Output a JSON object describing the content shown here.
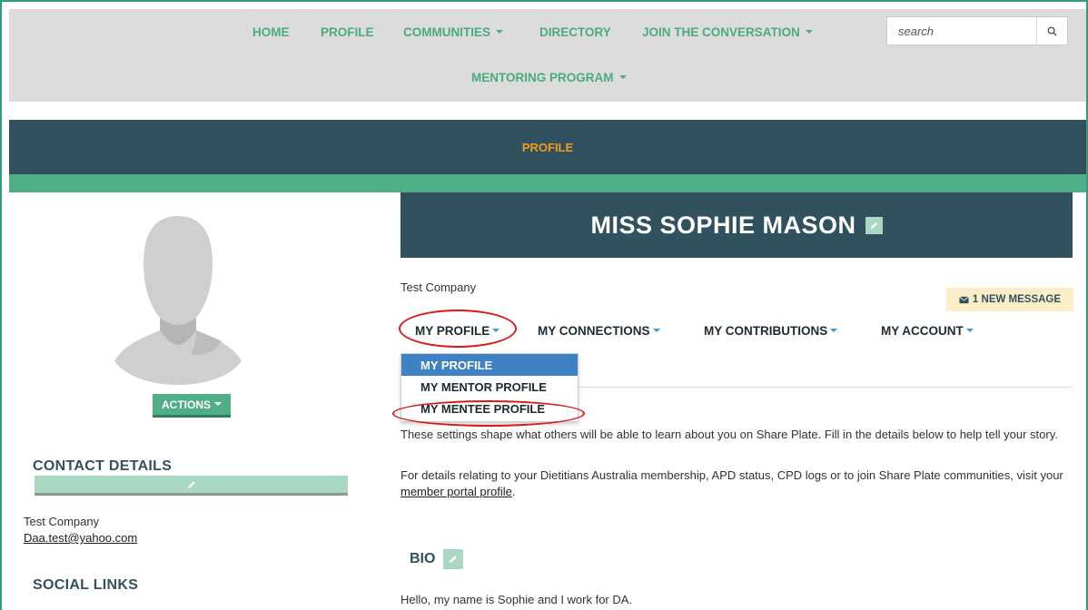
{
  "nav": {
    "items": [
      {
        "label": "HOME",
        "caret": false
      },
      {
        "label": "PROFILE",
        "caret": false
      },
      {
        "label": "COMMUNITIES",
        "caret": true
      },
      {
        "label": "DIRECTORY",
        "caret": false
      },
      {
        "label": "JOIN THE CONVERSATION",
        "caret": true
      },
      {
        "label": "MENTORING PROGRAM",
        "caret": true
      }
    ],
    "search_placeholder": "search"
  },
  "page_band": {
    "title": "PROFILE"
  },
  "left": {
    "actions_label": "ACTIONS",
    "contact_heading": "CONTACT DETAILS",
    "company": "Test Company",
    "email": "Daa.test@yahoo.com",
    "social_heading": "SOCIAL LINKS"
  },
  "profile": {
    "name": "MISS SOPHIE MASON",
    "company": "Test Company",
    "message_badge": "1 NEW MESSAGE",
    "tabs": [
      {
        "label": "MY PROFILE"
      },
      {
        "label": "MY CONNECTIONS"
      },
      {
        "label": "MY CONTRIBUTIONS"
      },
      {
        "label": "MY ACCOUNT"
      }
    ],
    "dropdown": [
      {
        "label": "MY PROFILE",
        "active": true
      },
      {
        "label": "MY MENTOR PROFILE",
        "active": false
      },
      {
        "label": "MY MENTEE PROFILE",
        "active": false
      }
    ],
    "intro_text": "These settings shape what others will be able to learn about you on Share Plate. Fill in the details below to help tell your story.",
    "details_text": "For details relating to your Dietitians Australia membership, APD status, CPD logs or to join Share Plate communities, visit your",
    "details_link": "member portal profile",
    "details_end": ".",
    "bio_heading": "BIO",
    "bio_text": "Hello, my name is Sophie and I work for DA."
  },
  "colors": {
    "accent_green": "#4fae85",
    "dark_teal": "#32515f",
    "orange": "#f39a1f",
    "highlight_ring": "#d91a1a",
    "dropdown_active": "#3e82c4"
  }
}
